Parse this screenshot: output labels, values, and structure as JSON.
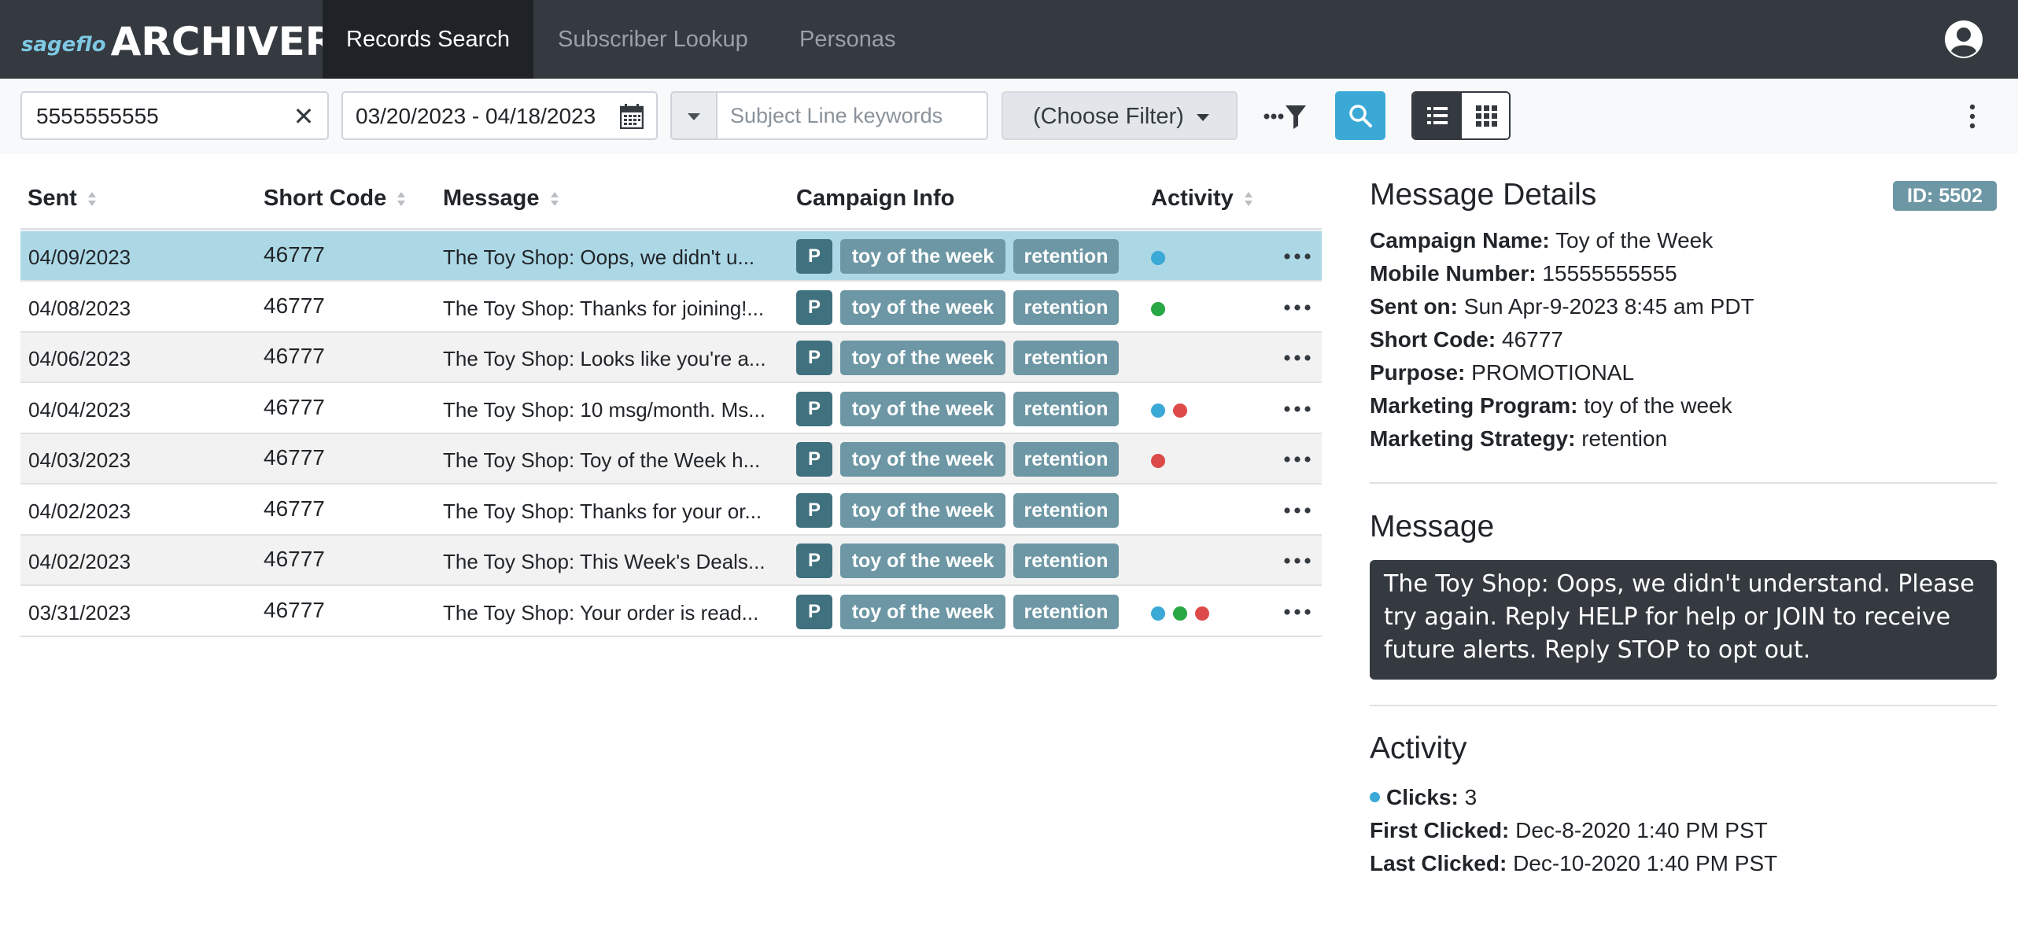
{
  "brand": {
    "small": "sageflo",
    "big": "ARCHIVER"
  },
  "nav": {
    "tabs": [
      {
        "label": "Records Search"
      },
      {
        "label": "Subscriber Lookup"
      },
      {
        "label": "Personas"
      }
    ]
  },
  "toolbar": {
    "search_value": "5555555555",
    "date_range": "03/20/2023 - 04/18/2023",
    "subject_placeholder": "Subject Line keywords",
    "filter_label": "(Choose Filter)"
  },
  "table": {
    "headers": {
      "sent": "Sent",
      "short_code": "Short Code",
      "message": "Message",
      "campaign_info": "Campaign Info",
      "activity": "Activity"
    },
    "rows": [
      {
        "sent": "04/09/2023",
        "short_code": "46777",
        "message": "The Toy Shop: Oops, we didn't u...",
        "purpose": "P",
        "program": "toy of the week",
        "strategy": "retention",
        "activity": [
          "click"
        ]
      },
      {
        "sent": "04/08/2023",
        "short_code": "46777",
        "message": "The Toy Shop: Thanks for joining!...",
        "purpose": "P",
        "program": "toy of the week",
        "strategy": "retention",
        "activity": [
          "reply"
        ]
      },
      {
        "sent": "04/06/2023",
        "short_code": "46777",
        "message": "The Toy Shop: Looks like you're a...",
        "purpose": "P",
        "program": "toy of the week",
        "strategy": "retention",
        "activity": []
      },
      {
        "sent": "04/04/2023",
        "short_code": "46777",
        "message": "The Toy Shop: 10 msg/month. Ms...",
        "purpose": "P",
        "program": "toy of the week",
        "strategy": "retention",
        "activity": [
          "click",
          "optout"
        ]
      },
      {
        "sent": "04/03/2023",
        "short_code": "46777",
        "message": "The Toy Shop: Toy of the Week h...",
        "purpose": "P",
        "program": "toy of the week",
        "strategy": "retention",
        "activity": [
          "optout"
        ]
      },
      {
        "sent": "04/02/2023",
        "short_code": "46777",
        "message": "The Toy Shop: Thanks for your or...",
        "purpose": "P",
        "program": "toy of the week",
        "strategy": "retention",
        "activity": []
      },
      {
        "sent": "04/02/2023",
        "short_code": "46777",
        "message": "The Toy Shop: This Week's Deals...",
        "purpose": "P",
        "program": "toy of the week",
        "strategy": "retention",
        "activity": []
      },
      {
        "sent": "03/31/2023",
        "short_code": "46777",
        "message": "The Toy Shop: Your order is read...",
        "purpose": "P",
        "program": "toy of the week",
        "strategy": "retention",
        "activity": [
          "click",
          "reply",
          "optout"
        ]
      }
    ]
  },
  "activity_colors": {
    "click": "#3aa9d6",
    "reply": "#28a745",
    "optout": "#dc4a4a"
  },
  "details": {
    "title": "Message Details",
    "id_badge": "ID: 5502",
    "campaign_name_label": "Campaign Name:",
    "campaign_name": "Toy of the Week",
    "mobile_label": "Mobile Number:",
    "mobile": "15555555555",
    "sent_on_label": "Sent on:",
    "sent_on": "Sun Apr-9-2023 8:45 am PDT",
    "short_code_label": "Short Code:",
    "short_code": "46777",
    "purpose_label": "Purpose:",
    "purpose": "PROMOTIONAL",
    "program_label": "Marketing Program:",
    "program": "toy of the week",
    "strategy_label": "Marketing Strategy:",
    "strategy": "retention",
    "message_title": "Message",
    "message_text": "The Toy Shop: Oops, we didn't understand. Please try again. Reply HELP for help or JOIN to receive future alerts. Reply STOP to opt out.",
    "activity_title": "Activity",
    "clicks_label": "Clicks:",
    "clicks": "3",
    "first_clicked_label": "First Clicked:",
    "first_clicked": "Dec-8-2020 1:40 PM PST",
    "last_clicked_label": "Last Clicked:",
    "last_clicked": "Dec-10-2020 1:40 PM PST"
  }
}
